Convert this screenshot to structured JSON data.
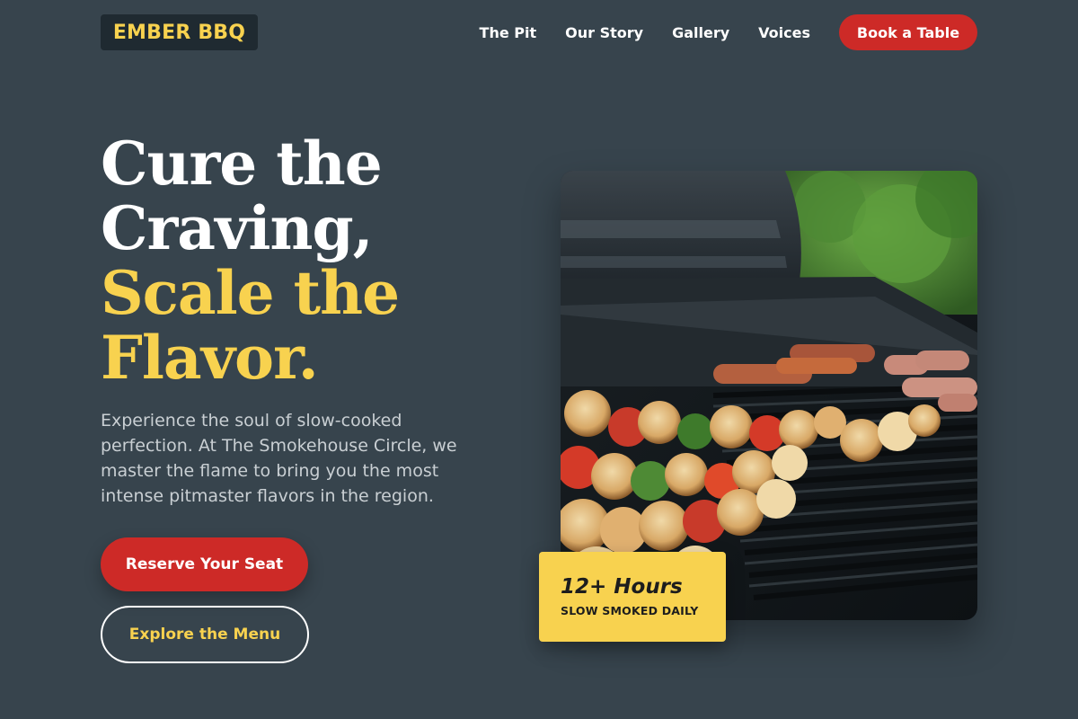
{
  "header": {
    "logo": "EMBER BBQ",
    "nav": [
      "The Pit",
      "Our Story",
      "Gallery",
      "Voices"
    ],
    "cta": "Book a Table"
  },
  "hero": {
    "title_line1": "Cure the",
    "title_line2": "Craving,",
    "title_line3": "Scale the",
    "title_line4": "Flavor.",
    "description": "Experience the soul of slow-cooked perfection. At The Smokehouse Circle, we master the flame to bring you the most intense pitmaster flavors in the region.",
    "primary_button": "Reserve Your Seat",
    "secondary_button": "Explore the Menu"
  },
  "badge": {
    "number": "12+ Hours",
    "caption": "SLOW SMOKED DAILY"
  },
  "image": {
    "subject": "grill-skewers-photo"
  },
  "colors": {
    "background": "#37444d",
    "accent_yellow": "#f8d24f",
    "accent_red": "#cd2a27",
    "logo_bg": "#1f2a31"
  }
}
